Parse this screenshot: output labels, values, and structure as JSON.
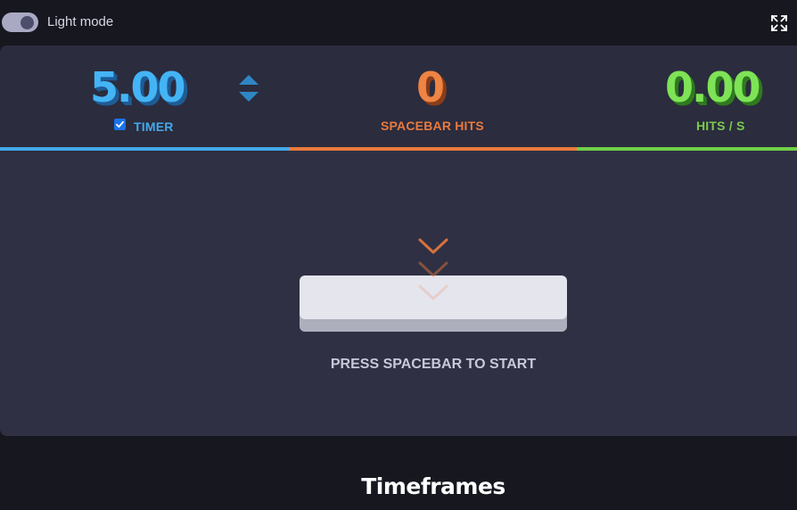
{
  "topbar": {
    "theme_toggle_label": "Light mode",
    "theme_toggle_on": true,
    "fullscreen_icon": "expand-icon"
  },
  "stats": {
    "timer": {
      "value": "5.00",
      "label": "TIMER",
      "enabled": true,
      "color": "#43a9ea",
      "stepper_icon": "up-down-arrows-icon"
    },
    "spacebar_hits": {
      "value": "0",
      "label": "SPACEBAR HITS",
      "color": "#e97a3d"
    },
    "hits_per_second": {
      "value": "0.00",
      "label": "HITS / S",
      "color": "#6fd048"
    }
  },
  "main": {
    "hint_icon": "chevron-down-icon",
    "spacebar_key_icon": "spacebar-key-icon",
    "instruction": "PRESS SPACEBAR TO START"
  },
  "section": {
    "title": "Timeframes"
  },
  "colors": {
    "background": "#16171f",
    "panel": "#2f3043",
    "stats_panel": "#2b2c3e",
    "accent_blue": "#43a9ea",
    "accent_orange": "#e97a3d",
    "accent_green": "#6fd048"
  }
}
